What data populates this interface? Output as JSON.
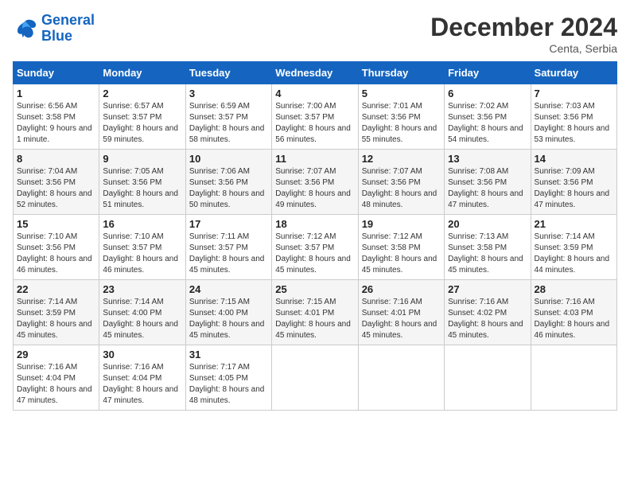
{
  "header": {
    "logo_line1": "General",
    "logo_line2": "Blue",
    "month_title": "December 2024",
    "location": "Centa, Serbia"
  },
  "days_of_week": [
    "Sunday",
    "Monday",
    "Tuesday",
    "Wednesday",
    "Thursday",
    "Friday",
    "Saturday"
  ],
  "weeks": [
    [
      {
        "day": "1",
        "sunrise": "Sunrise: 6:56 AM",
        "sunset": "Sunset: 3:58 PM",
        "daylight": "Daylight: 9 hours and 1 minute."
      },
      {
        "day": "2",
        "sunrise": "Sunrise: 6:57 AM",
        "sunset": "Sunset: 3:57 PM",
        "daylight": "Daylight: 8 hours and 59 minutes."
      },
      {
        "day": "3",
        "sunrise": "Sunrise: 6:59 AM",
        "sunset": "Sunset: 3:57 PM",
        "daylight": "Daylight: 8 hours and 58 minutes."
      },
      {
        "day": "4",
        "sunrise": "Sunrise: 7:00 AM",
        "sunset": "Sunset: 3:57 PM",
        "daylight": "Daylight: 8 hours and 56 minutes."
      },
      {
        "day": "5",
        "sunrise": "Sunrise: 7:01 AM",
        "sunset": "Sunset: 3:56 PM",
        "daylight": "Daylight: 8 hours and 55 minutes."
      },
      {
        "day": "6",
        "sunrise": "Sunrise: 7:02 AM",
        "sunset": "Sunset: 3:56 PM",
        "daylight": "Daylight: 8 hours and 54 minutes."
      },
      {
        "day": "7",
        "sunrise": "Sunrise: 7:03 AM",
        "sunset": "Sunset: 3:56 PM",
        "daylight": "Daylight: 8 hours and 53 minutes."
      }
    ],
    [
      {
        "day": "8",
        "sunrise": "Sunrise: 7:04 AM",
        "sunset": "Sunset: 3:56 PM",
        "daylight": "Daylight: 8 hours and 52 minutes."
      },
      {
        "day": "9",
        "sunrise": "Sunrise: 7:05 AM",
        "sunset": "Sunset: 3:56 PM",
        "daylight": "Daylight: 8 hours and 51 minutes."
      },
      {
        "day": "10",
        "sunrise": "Sunrise: 7:06 AM",
        "sunset": "Sunset: 3:56 PM",
        "daylight": "Daylight: 8 hours and 50 minutes."
      },
      {
        "day": "11",
        "sunrise": "Sunrise: 7:07 AM",
        "sunset": "Sunset: 3:56 PM",
        "daylight": "Daylight: 8 hours and 49 minutes."
      },
      {
        "day": "12",
        "sunrise": "Sunrise: 7:07 AM",
        "sunset": "Sunset: 3:56 PM",
        "daylight": "Daylight: 8 hours and 48 minutes."
      },
      {
        "day": "13",
        "sunrise": "Sunrise: 7:08 AM",
        "sunset": "Sunset: 3:56 PM",
        "daylight": "Daylight: 8 hours and 47 minutes."
      },
      {
        "day": "14",
        "sunrise": "Sunrise: 7:09 AM",
        "sunset": "Sunset: 3:56 PM",
        "daylight": "Daylight: 8 hours and 47 minutes."
      }
    ],
    [
      {
        "day": "15",
        "sunrise": "Sunrise: 7:10 AM",
        "sunset": "Sunset: 3:56 PM",
        "daylight": "Daylight: 8 hours and 46 minutes."
      },
      {
        "day": "16",
        "sunrise": "Sunrise: 7:10 AM",
        "sunset": "Sunset: 3:57 PM",
        "daylight": "Daylight: 8 hours and 46 minutes."
      },
      {
        "day": "17",
        "sunrise": "Sunrise: 7:11 AM",
        "sunset": "Sunset: 3:57 PM",
        "daylight": "Daylight: 8 hours and 45 minutes."
      },
      {
        "day": "18",
        "sunrise": "Sunrise: 7:12 AM",
        "sunset": "Sunset: 3:57 PM",
        "daylight": "Daylight: 8 hours and 45 minutes."
      },
      {
        "day": "19",
        "sunrise": "Sunrise: 7:12 AM",
        "sunset": "Sunset: 3:58 PM",
        "daylight": "Daylight: 8 hours and 45 minutes."
      },
      {
        "day": "20",
        "sunrise": "Sunrise: 7:13 AM",
        "sunset": "Sunset: 3:58 PM",
        "daylight": "Daylight: 8 hours and 45 minutes."
      },
      {
        "day": "21",
        "sunrise": "Sunrise: 7:14 AM",
        "sunset": "Sunset: 3:59 PM",
        "daylight": "Daylight: 8 hours and 44 minutes."
      }
    ],
    [
      {
        "day": "22",
        "sunrise": "Sunrise: 7:14 AM",
        "sunset": "Sunset: 3:59 PM",
        "daylight": "Daylight: 8 hours and 45 minutes."
      },
      {
        "day": "23",
        "sunrise": "Sunrise: 7:14 AM",
        "sunset": "Sunset: 4:00 PM",
        "daylight": "Daylight: 8 hours and 45 minutes."
      },
      {
        "day": "24",
        "sunrise": "Sunrise: 7:15 AM",
        "sunset": "Sunset: 4:00 PM",
        "daylight": "Daylight: 8 hours and 45 minutes."
      },
      {
        "day": "25",
        "sunrise": "Sunrise: 7:15 AM",
        "sunset": "Sunset: 4:01 PM",
        "daylight": "Daylight: 8 hours and 45 minutes."
      },
      {
        "day": "26",
        "sunrise": "Sunrise: 7:16 AM",
        "sunset": "Sunset: 4:01 PM",
        "daylight": "Daylight: 8 hours and 45 minutes."
      },
      {
        "day": "27",
        "sunrise": "Sunrise: 7:16 AM",
        "sunset": "Sunset: 4:02 PM",
        "daylight": "Daylight: 8 hours and 45 minutes."
      },
      {
        "day": "28",
        "sunrise": "Sunrise: 7:16 AM",
        "sunset": "Sunset: 4:03 PM",
        "daylight": "Daylight: 8 hours and 46 minutes."
      }
    ],
    [
      {
        "day": "29",
        "sunrise": "Sunrise: 7:16 AM",
        "sunset": "Sunset: 4:04 PM",
        "daylight": "Daylight: 8 hours and 47 minutes."
      },
      {
        "day": "30",
        "sunrise": "Sunrise: 7:16 AM",
        "sunset": "Sunset: 4:04 PM",
        "daylight": "Daylight: 8 hours and 47 minutes."
      },
      {
        "day": "31",
        "sunrise": "Sunrise: 7:17 AM",
        "sunset": "Sunset: 4:05 PM",
        "daylight": "Daylight: 8 hours and 48 minutes."
      },
      null,
      null,
      null,
      null
    ]
  ]
}
